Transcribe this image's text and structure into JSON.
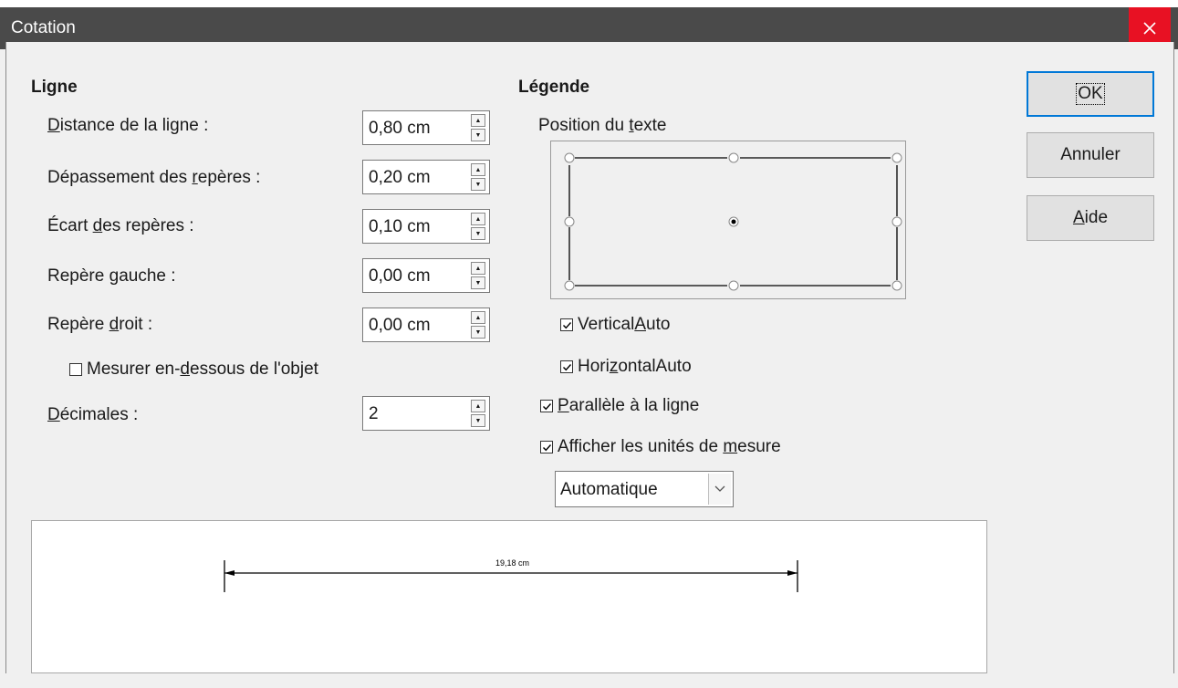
{
  "window": {
    "title": "Cotation"
  },
  "ligne": {
    "heading": "Ligne",
    "fields": [
      {
        "pre": "",
        "mnemonic": "D",
        "post": "istance de la ligne :",
        "value": "0,80 cm"
      },
      {
        "pre": "Dépassement des ",
        "mnemonic": "r",
        "post": "epères :",
        "value": "0,20 cm"
      },
      {
        "pre": "Écart ",
        "mnemonic": "d",
        "post": "es repères :",
        "value": "0,10 cm"
      },
      {
        "pre": "Repère ",
        "mnemonic": "g",
        "post": "auche :",
        "value": "0,00 cm"
      },
      {
        "pre": "Repère ",
        "mnemonic": "d",
        "post": "roit :",
        "value": "0,00 cm"
      }
    ],
    "below_checkbox": {
      "pre": "Mesurer en-",
      "mnemonic": "d",
      "post": "essous de l'objet",
      "checked": false
    },
    "decimals": {
      "pre": "",
      "mnemonic": "D",
      "post": "écimales :",
      "value": "2"
    }
  },
  "legende": {
    "heading": "Légende",
    "position_label": {
      "pre": "Position du ",
      "mnemonic": "t",
      "post": "exte"
    },
    "vertical_auto": {
      "pre": "Vertical",
      "mnemonic": "A",
      "post": "uto",
      "checked": true
    },
    "horizontal_auto": {
      "pre": "Hori",
      "mnemonic": "z",
      "post": "ontalAuto",
      "checked": true
    },
    "parallel": {
      "pre": "",
      "mnemonic": "P",
      "post": "arallèle à la ligne",
      "checked": true
    },
    "show_units": {
      "pre": "Afficher les unités de ",
      "mnemonic": "m",
      "post": "esure",
      "checked": true
    },
    "unit_select": {
      "value": "Automatique"
    }
  },
  "buttons": {
    "ok": "OK",
    "cancel": "Annuler",
    "help": {
      "pre": "",
      "mnemonic": "A",
      "post": "ide"
    }
  },
  "preview": {
    "measurement": "19,18 cm"
  },
  "icons": {
    "close": "close-icon",
    "spin_up": "spin-up-icon",
    "spin_down": "spin-down-icon",
    "check": "checkmark-icon",
    "dropdown": "chevron-down-icon"
  },
  "colors": {
    "titlebar": "#4a4a4a",
    "close_button": "#e81123",
    "accent": "#0078d7"
  }
}
